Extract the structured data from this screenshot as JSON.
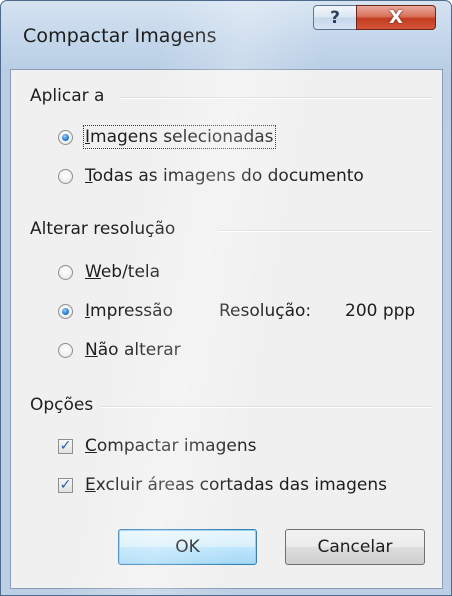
{
  "window": {
    "title": "Compactar Imagens",
    "help_glyph": "?",
    "close_glyph": "X"
  },
  "apply_group": {
    "label": "Aplicar a",
    "options": [
      {
        "prefix": "",
        "accel": "I",
        "rest": "magens selecionadas",
        "checked": true
      },
      {
        "prefix": "",
        "accel": "T",
        "rest": "odas as imagens do documento",
        "checked": false
      }
    ]
  },
  "resolution_group": {
    "label": "Alterar resolução",
    "options": [
      {
        "prefix": "",
        "accel": "W",
        "rest": "eb/tela",
        "checked": false
      },
      {
        "prefix": "",
        "accel": "I",
        "rest": "mpressão",
        "checked": true
      },
      {
        "prefix": "",
        "accel": "N",
        "rest": "ão alterar",
        "checked": false
      }
    ],
    "resolution_label": "Resolução:",
    "resolution_value": "200 ppp"
  },
  "options_group": {
    "label": "Opções",
    "items": [
      {
        "accel": "C",
        "rest": "ompactar imagens",
        "checked": true
      },
      {
        "accel": "E",
        "rest": "xcluir áreas cortadas das imagens",
        "checked": true
      }
    ]
  },
  "buttons": {
    "ok": "OK",
    "cancel": "Cancelar"
  },
  "colors": {
    "title_bar": "#c3d6ea",
    "close_button": "#c23d1f",
    "dialog_face": "#f0f0f0",
    "default_button": "#bee6fd"
  },
  "icons": {
    "help": "help-icon",
    "close": "close-icon",
    "check": "checkmark-icon"
  }
}
